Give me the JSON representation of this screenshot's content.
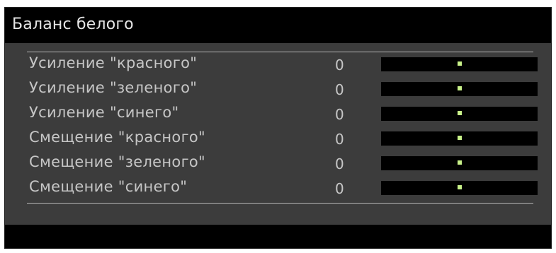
{
  "menu": {
    "title": "Баланс белого",
    "items": [
      {
        "label": "Усиление \"красного\"",
        "value": "0",
        "level": 0.5
      },
      {
        "label": "Усиление \"зеленого\"",
        "value": "0",
        "level": 0.5
      },
      {
        "label": "Усиление \"синего\"",
        "value": "0",
        "level": 0.5
      },
      {
        "label": "Смещение \"красного\"",
        "value": "0",
        "level": 0.5
      },
      {
        "label": "Смещение \"зеленого\"",
        "value": "0",
        "level": 0.5
      },
      {
        "label": "Смещение \"синего\"",
        "value": "0",
        "level": 0.5
      }
    ]
  },
  "colors": {
    "panel": "#3c3c3c",
    "bar": "#000000",
    "text": "#c6c6c6",
    "knob": "#c9f28a"
  }
}
